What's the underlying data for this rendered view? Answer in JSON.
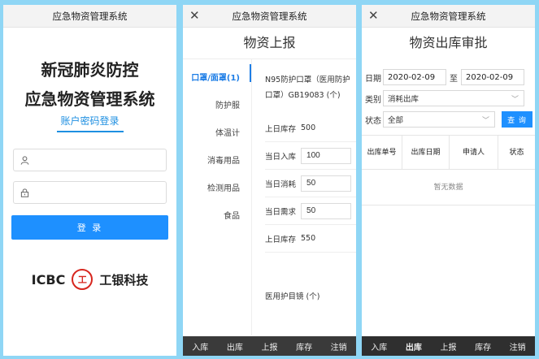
{
  "login": {
    "header_title": "应急物资管理系统",
    "title_line1": "新冠肺炎防控",
    "title_line2": "应急物资管理系统",
    "tab_label": "账户密码登录",
    "username_placeholder": "",
    "password_placeholder": "",
    "login_button": "登 录",
    "logo_latin": "ICBC",
    "logo_seal": "工",
    "logo_cn": "工银科技"
  },
  "report": {
    "header_title": "应急物资管理系统",
    "page_title": "物资上报",
    "categories": [
      "口罩/面罩(1)",
      "防护服",
      "体温计",
      "消毒用品",
      "检测用品",
      "食品"
    ],
    "item_name": "N95防护口罩（医用防护口罩）GB19083 (个)",
    "prev_stock_label": "上日库存",
    "prev_stock_value": "500",
    "in_label": "当日入库",
    "in_value": "100",
    "use_label": "当日消耗",
    "use_value": "50",
    "need_label": "当日需求",
    "need_value": "50",
    "stock_label": "上日库存",
    "stock_value": "550",
    "next_item": "医用护目镜 (个)"
  },
  "approval": {
    "header_title": "应急物资管理系统",
    "page_title": "物资出库审批",
    "date_label": "日期",
    "date_from": "2020-02-09",
    "date_to_sep": "至",
    "date_to": "2020-02-09",
    "type_label": "类别",
    "type_value": "消耗出库",
    "status_label": "状态",
    "status_value": "全部",
    "query_button": "查 询",
    "columns": [
      "出库单号",
      "出库日期",
      "申请人",
      "状态"
    ],
    "empty_text": "暂无数据"
  },
  "nav": [
    "入库",
    "出库",
    "上报",
    "库存",
    "注销"
  ]
}
